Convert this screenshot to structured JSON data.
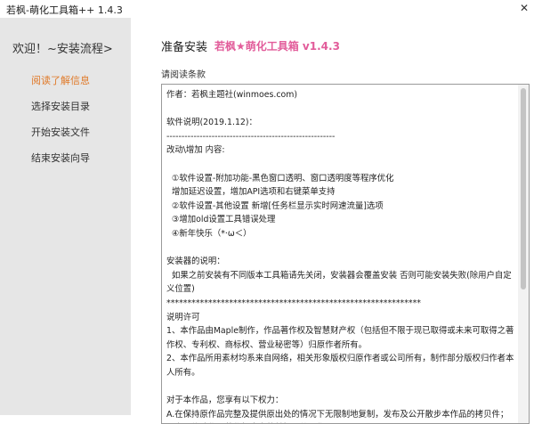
{
  "window": {
    "title": "若枫-萌化工具箱++ 1.4.3",
    "close_label": "✕"
  },
  "sidebar": {
    "title": "欢迎！~安装流程>",
    "steps": [
      {
        "label": "阅读了解信息",
        "active": true
      },
      {
        "label": "选择安装目录",
        "active": false
      },
      {
        "label": "开始安装文件",
        "active": false
      },
      {
        "label": "结束安装向导",
        "active": false
      }
    ]
  },
  "main": {
    "heading": "准备安装",
    "app_name": "若枫★萌化工具箱 v1.4.3",
    "sublabel": "请阅读条款",
    "license_text": "作者：若枫主题社(winmoes.com)\n\n软件说明(2019.1.12)：\n--------------------------------------------------------\n改动\\增加 内容:\n\n  ①软件设置-附加功能-黑色窗口透明、窗口透明度等程序优化\n  增加延迟设置，增加API选项和右键菜单支持\n  ②软件设置-其他设置 新增[任务栏显示实时网速流量]选项\n  ③增加old设置工具错误处理\n  ④新年快乐（*·ω＜）\n\n安装器的说明：\n  如果之前安装有不同版本工具箱请先关闭，安装器会覆盖安装 否则可能安装失败(除用户自定义位置)\n*************************************************************\n说明许可\n1、本作品由Maple制作，作品著作权及智慧财产权（包括但不限于现已取得或未来可取得之著作权、专利权、商标权、营业秘密等）归原作者所有。\n2、本作品所用素材均系来自网络，相关形象版权归原作者或公司所有，制作部分版权归作者本人所有。\n\n对于本作品，您享有以下权力：\nA.在保持原作品完整及提供原出处的情况下无限制地复制，发布及公开散步本作品的拷贝件；\nB.在不修改作品著作权内容的前提下使用作品"
  }
}
